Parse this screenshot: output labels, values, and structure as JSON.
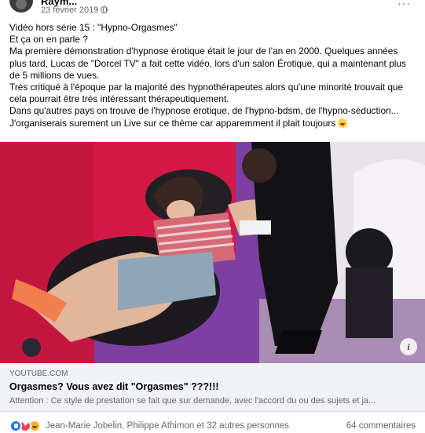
{
  "post": {
    "author": "Raym...",
    "date": "23 février 2019",
    "date_separator": "·",
    "privacy_icon": "globe-icon",
    "more_label": "···",
    "lines": [
      "Vidéo hors série 15 : \"Hypno-Orgasmes\"",
      "Et ça on en parle ?",
      "Ma première démonstration d'hypnose érotique était le jour de l'an en 2000. Quelques années",
      "plus tard, Lucas de \"Dorcel TV\" a fait cette vidéo, lors d'un salon Érotique, qui a maintenant plus",
      "de 5 millions de vues.",
      "Très critiqué à l'époque par la majorité des hypnothérapeutes alors qu'une minorité trouvait que",
      "cela pourrait être très intéressant thérapeutiquement.",
      "Dans qu'autres pays on trouve de l'hypnose érotique, de l'hypno-bdsm, de l'hypno-séduction...",
      "J'organiserais surement un Live sur ce thème car apparemment il plait toujours"
    ],
    "emoji_icon": "grinning-squinting-face-icon"
  },
  "media": {
    "info_label": "i"
  },
  "link": {
    "domain": "YOUTUBE.COM",
    "title": "Orgasmes? Vous avez dit \"Orgasmes\" ???!!!",
    "description": "Attention : Ce style de prestation se fait que sur demande, avec l'accord du ou des sujets et ja..."
  },
  "footer": {
    "reaction_icons": [
      "like-icon",
      "love-icon",
      "haha-icon"
    ],
    "reactors_text": "Jean-Marie Jobelin, Philippe Athimon et 32 autres personnes",
    "comments_text": "64 commentaires"
  },
  "colors": {
    "facebook_blue": "#1877f2",
    "love_red": "#f33e58",
    "haha_yellow": "#f7b125",
    "secondary_text": "#65676b",
    "link_bg": "#f0f2f5"
  }
}
